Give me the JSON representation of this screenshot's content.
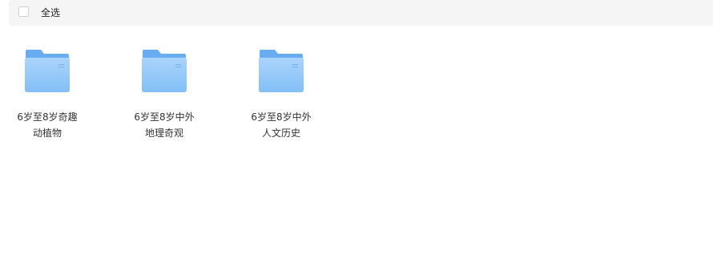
{
  "toolbar": {
    "select_all_label": "全选",
    "select_all_checked": false
  },
  "folders": [
    {
      "name_line1": "6岁至8岁奇趣",
      "name_line2": "动植物"
    },
    {
      "name_line1": "6岁至8岁中外",
      "name_line2": "地理奇观"
    },
    {
      "name_line1": "6岁至8岁中外",
      "name_line2": "人文历史"
    }
  ],
  "colors": {
    "toolbar_bg": "#f5f5f6",
    "folder_back": "#6aaef0",
    "folder_front_top": "#a9d3fb",
    "folder_front_bottom": "#7fbcf5"
  },
  "icons": {
    "folder": "folder-icon"
  }
}
